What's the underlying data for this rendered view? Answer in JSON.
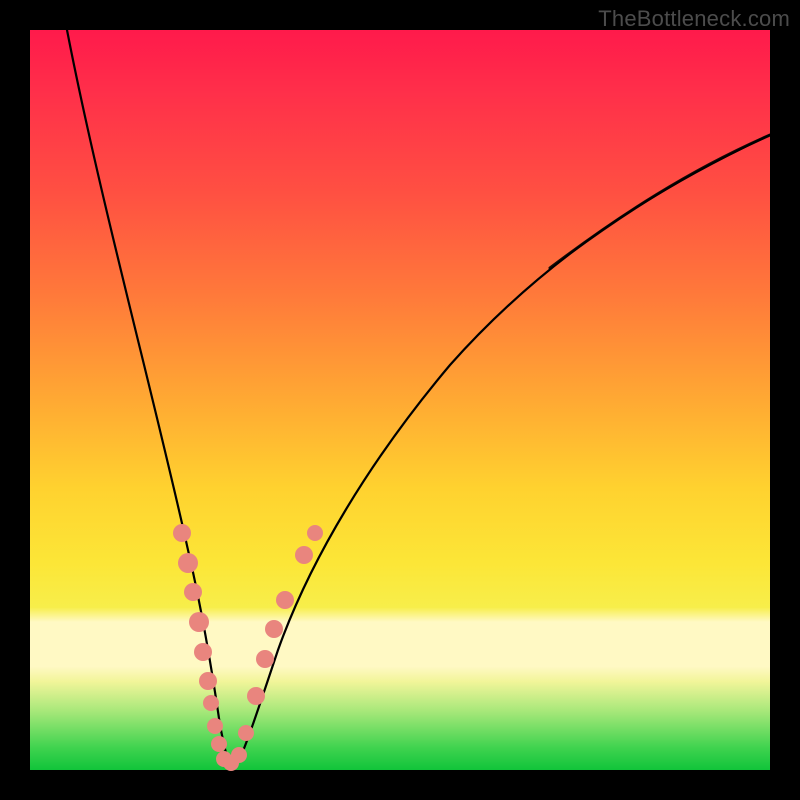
{
  "watermark": "TheBottleneck.com",
  "colors": {
    "dot": "#e9857e",
    "curve": "#000000",
    "frame": "#000000"
  },
  "chart_data": {
    "type": "line",
    "title": "",
    "xlabel": "",
    "ylabel": "",
    "xlim": [
      0,
      100
    ],
    "ylim": [
      0,
      100
    ],
    "grid": false,
    "legend": false,
    "note": "Axes are unlabeled in the source image; values are estimated in 0–100 plot-area percent coordinates. y=0 is the top edge of the colored plot area, y=100 is the bottom (green) edge.",
    "series": [
      {
        "name": "bottleneck-curve",
        "x": [
          5,
          8,
          12,
          16,
          18,
          20,
          22,
          23.5,
          25,
          26.5,
          28,
          30,
          34,
          40,
          50,
          62,
          76,
          90,
          100
        ],
        "y": [
          0,
          20,
          42,
          62,
          72,
          80,
          88,
          94,
          98,
          99,
          96,
          90,
          80,
          68,
          52,
          38,
          26,
          18,
          14
        ]
      }
    ],
    "points": [
      {
        "name": "left-dot-1",
        "x": 20.5,
        "y": 68
      },
      {
        "name": "left-dot-2",
        "x": 21.3,
        "y": 72
      },
      {
        "name": "left-dot-3",
        "x": 22.0,
        "y": 76
      },
      {
        "name": "left-dot-4",
        "x": 22.8,
        "y": 80
      },
      {
        "name": "left-dot-5",
        "x": 23.4,
        "y": 84
      },
      {
        "name": "left-dot-6",
        "x": 24.0,
        "y": 88
      },
      {
        "name": "left-dot-7",
        "x": 24.5,
        "y": 91
      },
      {
        "name": "left-dot-8",
        "x": 25.0,
        "y": 94
      },
      {
        "name": "left-dot-9",
        "x": 25.5,
        "y": 96.5
      },
      {
        "name": "vertex-dot-1",
        "x": 26.2,
        "y": 98.5
      },
      {
        "name": "vertex-dot-2",
        "x": 27.2,
        "y": 99
      },
      {
        "name": "vertex-dot-3",
        "x": 28.2,
        "y": 98
      },
      {
        "name": "right-dot-1",
        "x": 29.2,
        "y": 95
      },
      {
        "name": "right-dot-2",
        "x": 30.5,
        "y": 90
      },
      {
        "name": "right-dot-3",
        "x": 31.8,
        "y": 85
      },
      {
        "name": "right-dot-4",
        "x": 33.0,
        "y": 81
      },
      {
        "name": "right-dot-5",
        "x": 34.5,
        "y": 77
      },
      {
        "name": "right-dot-6",
        "x": 37.0,
        "y": 71
      },
      {
        "name": "right-dot-7",
        "x": 38.5,
        "y": 68
      }
    ]
  }
}
